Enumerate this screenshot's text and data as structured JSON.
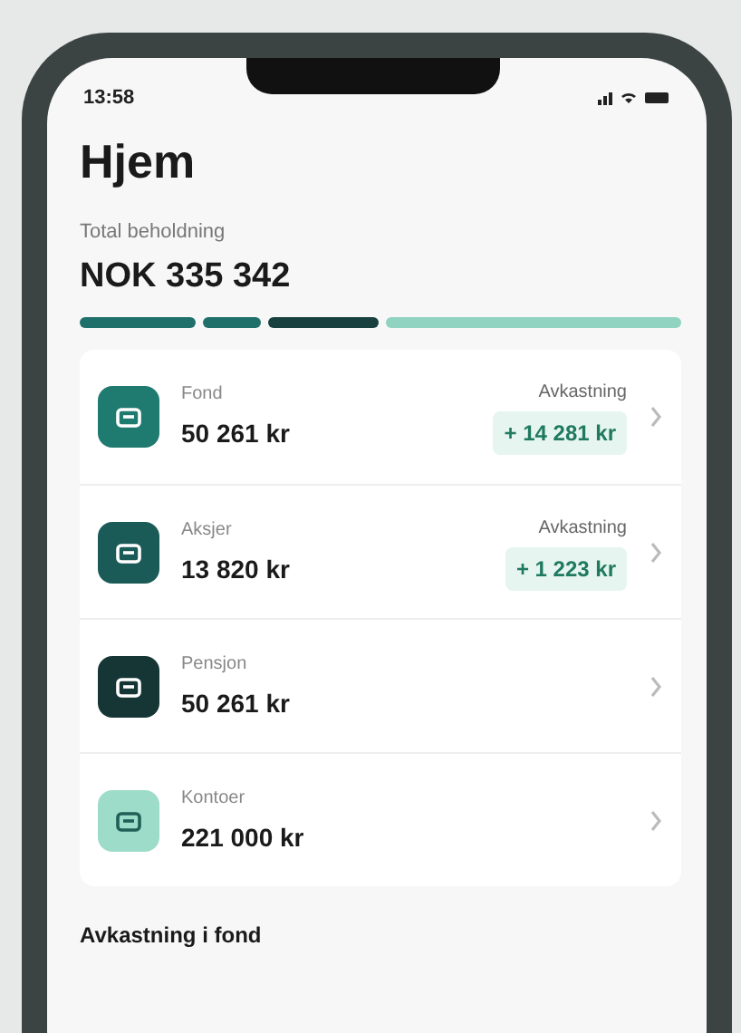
{
  "status_bar": {
    "time": "13:58"
  },
  "title": "Hjem",
  "total": {
    "label": "Total beholdning",
    "value": "NOK 335 342"
  },
  "accounts": [
    {
      "label": "Fond",
      "amount": "50 261 kr",
      "color": "#1f7a6f",
      "return_label": "Avkastning",
      "return_value": "+ 14 281 kr"
    },
    {
      "label": "Aksjer",
      "amount": "13 820 kr",
      "color": "#1a5a57",
      "return_label": "Avkastning",
      "return_value": "+ 1 223 kr"
    },
    {
      "label": "Pensjon",
      "amount": "50 261 kr",
      "color": "#163636"
    },
    {
      "label": "Kontoer",
      "amount": "221 000 kr",
      "color": "#9edcca"
    }
  ],
  "section_title": "Avkastning i fond"
}
